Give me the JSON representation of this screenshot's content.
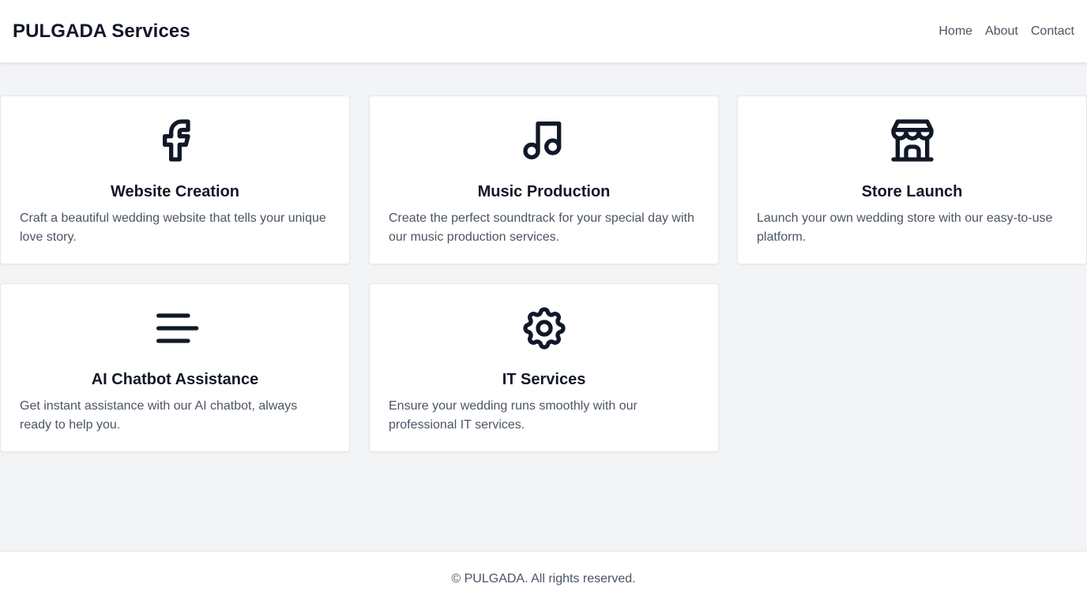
{
  "header": {
    "brand": "PULGADA Services",
    "nav": [
      "Home",
      "About",
      "Contact"
    ]
  },
  "services": [
    {
      "icon": "facebook-icon",
      "title": "Website Creation",
      "description": "Craft a beautiful wedding website that tells your unique love story."
    },
    {
      "icon": "music-note-icon",
      "title": "Music Production",
      "description": "Create the perfect soundtrack for your special day with our music production services."
    },
    {
      "icon": "store-icon",
      "title": "Store Launch",
      "description": "Launch your own wedding store with our easy-to-use platform."
    },
    {
      "icon": "text-lines-icon",
      "title": "AI Chatbot Assistance",
      "description": "Get instant assistance with our AI chatbot, always ready to help you."
    },
    {
      "icon": "gear-icon",
      "title": "IT Services",
      "description": "Ensure your wedding runs smoothly with our professional IT services."
    }
  ],
  "footer": {
    "text": "© PULGADA. All rights reserved."
  },
  "colors": {
    "background": "#f3f4f6",
    "card": "#ffffff",
    "heading": "#111827",
    "body_text": "#4b5563",
    "border": "#e5e7eb"
  }
}
